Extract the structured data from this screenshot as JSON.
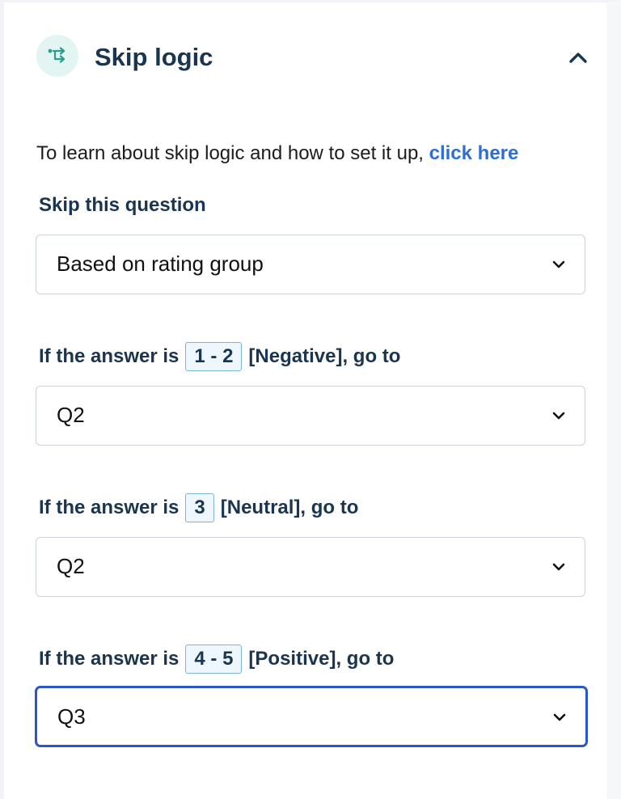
{
  "header": {
    "title": "Skip logic",
    "icon": "branch-arrow-icon",
    "collapse_icon": "chevron-up-icon",
    "icon_color": "#2a9d8f",
    "icon_bg": "#e3f5f3"
  },
  "intro": {
    "text": "To learn about skip logic and how to set it up, ",
    "link": "click here",
    "link_color": "#2e6fd1"
  },
  "skip_question": {
    "label": "Skip this question",
    "value": "Based on rating group"
  },
  "rules": [
    {
      "prefix": "If the answer is",
      "range": "1 - 2",
      "suffix": "[Negative], go to",
      "value": "Q2"
    },
    {
      "prefix": "If the answer is",
      "range": "3",
      "suffix": "[Neutral], go to",
      "value": "Q2"
    },
    {
      "prefix": "If the answer is",
      "range": "4 - 5",
      "suffix": "[Positive], go to",
      "value": "Q3"
    }
  ],
  "colors": {
    "title": "#1a3550",
    "focus_border": "#2a56c8",
    "chip_border": "#7fb4d0",
    "chip_bg": "#eef7fd"
  }
}
